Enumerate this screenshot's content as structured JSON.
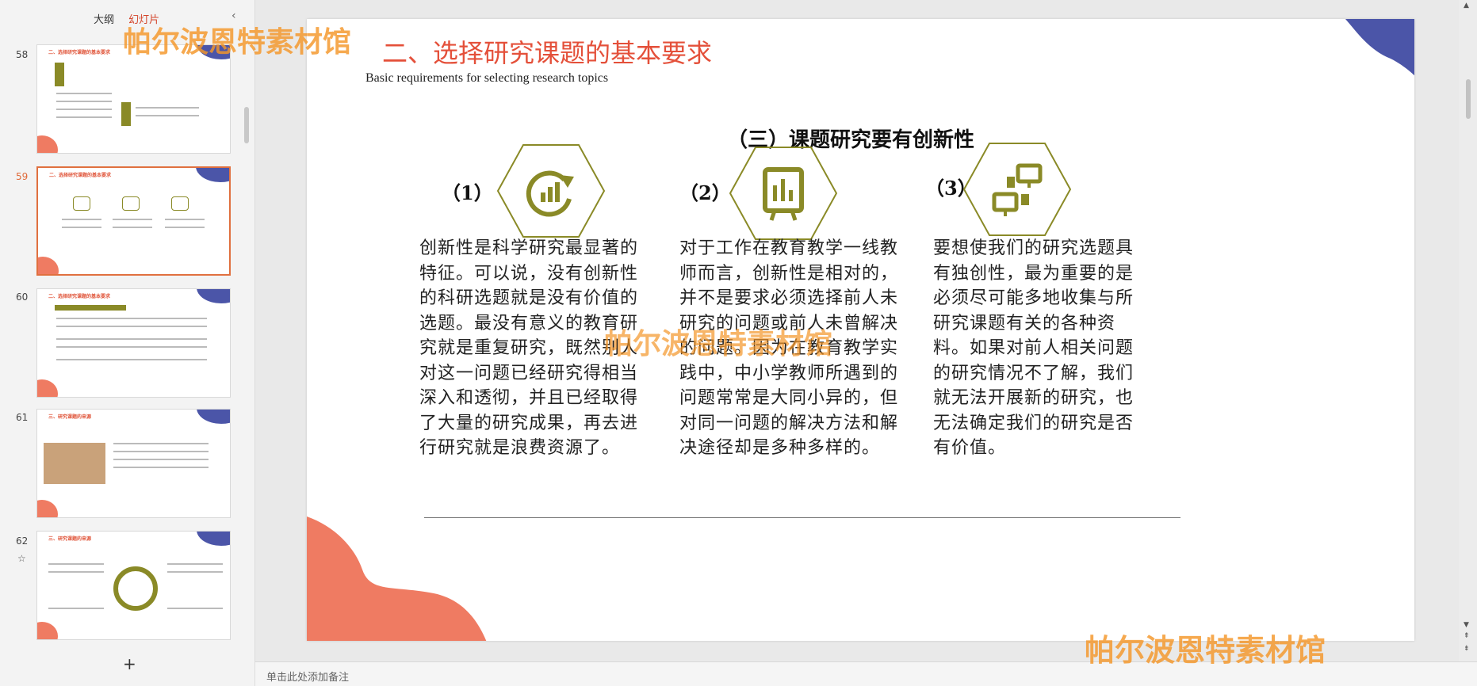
{
  "sidebar": {
    "tabs": [
      "大纲",
      "幻灯片"
    ],
    "collapse_icon": "chevron-left-icon",
    "add_icon": "plus-icon",
    "thumbnails": [
      {
        "number": "58",
        "title": "二、选择研究课题的基本要求"
      },
      {
        "number": "59",
        "title": "二、选择研究课题的基本要求"
      },
      {
        "number": "60",
        "title": "二、选择研究课题的基本要求"
      },
      {
        "number": "61",
        "title": "三、研究课题的来源"
      },
      {
        "number": "62",
        "title": "三、研究课题的来源"
      }
    ]
  },
  "slide": {
    "title": "二、选择研究课题的基本要求",
    "subtitle": "Basic requirements for selecting research topics",
    "section_title": "（三）课题研究要有创新性",
    "columns": [
      {
        "number": "（1）",
        "icon": "refresh-chart-icon",
        "text": "创新性是科学研究最显著的特征。可以说，没有创新性的科研选题就是没有价值的选题。最没有意义的教育研究就是重复研究，既然别人对这一问题已经研究得相当深入和透彻，并且已经取得了大量的研究成果，再去进行研究就是浪费资源了。"
      },
      {
        "number": "（2）",
        "icon": "presentation-board-icon",
        "text": "对于工作在教育教学一线教师而言，创新性是相对的，并不是要求必须选择前人未研究的问题或前人未曾解决的问题。因为在教育教学实践中，中小学教师所遇到的问题常常是大同小异的，但对同一问题的解决方法和解决途径却是多种多样的。"
      },
      {
        "number": "（3）",
        "icon": "network-computers-icon",
        "text": "要想使我们的研究选题具有独创性，最为重要的是必须尽可能多地收集与所研究课题有关的各种资料。如果对前人相关问题的研究情况不了解，我们就无法开展新的研究，也无法确定我们的研究是否有价值。"
      }
    ]
  },
  "notes": {
    "placeholder": "单击此处添加备注"
  },
  "watermark": "帕尔波恩特素材馆",
  "colors": {
    "accent_red": "#e4503a",
    "olive": "#8a8a27",
    "blob_blue": "#4b55a8",
    "blob_coral": "#ef7b62"
  }
}
